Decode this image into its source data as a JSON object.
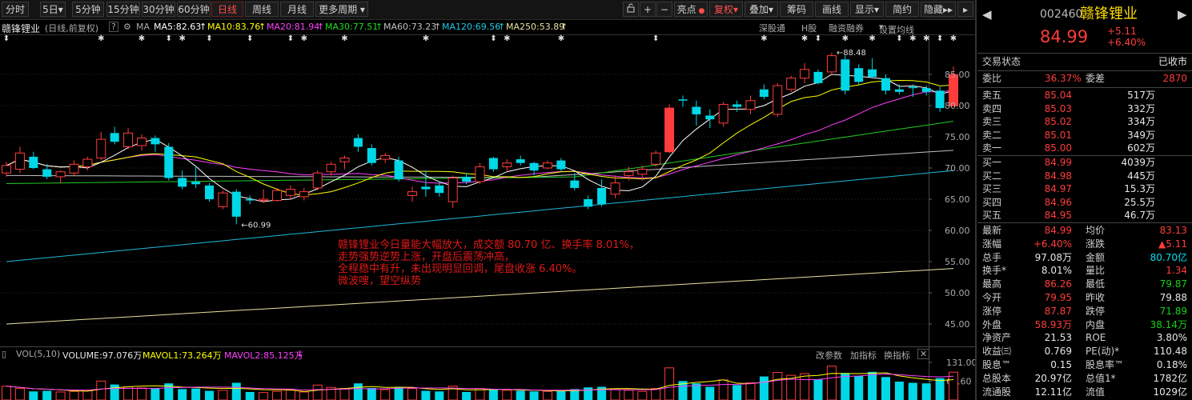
{
  "toolbar": {
    "periods": [
      "分时",
      "5日",
      "5分钟",
      "15分钟",
      "30分钟",
      "60分钟",
      "日线",
      "周线",
      "月线",
      "更多周期"
    ],
    "active_period": "日线",
    "right_buttons": [
      "亮点",
      "复权",
      "叠加",
      "筹码",
      "画线",
      "显示",
      "简约",
      "隐藏"
    ],
    "zoom_in": "+",
    "zoom_out": "−"
  },
  "ma_bar": {
    "stock_label": "赣锋锂业",
    "mode": "(日线,前复权)",
    "help": "?",
    "ma_tag": "MA",
    "ma5": "MA5:82.63",
    "ma10": "MA10:83.76",
    "ma20": "MA20:81.94",
    "ma30": "MA30:77.51",
    "ma60": "MA60:73.23",
    "ma120": "MA120:69.56",
    "ma250": "MA250:53.89",
    "arrow": "↑",
    "links": [
      "深股通",
      "H股",
      "融资融券",
      "设置均线"
    ]
  },
  "colors": {
    "up": "#ff3c3c",
    "down": "#00d8e8",
    "ma5": "#ffffff",
    "ma10": "#ffff00",
    "ma20": "#ff40ff",
    "ma30": "#22cc22",
    "ma60": "#c0c0c0",
    "ma120": "#1fb8d8",
    "ma250": "#e8e0a0"
  },
  "chart_data": {
    "type": "candlestick",
    "title": "赣锋锂业 日线 前复权",
    "ylim": [
      43,
      89
    ],
    "price_ticks": [
      85.0,
      80.0,
      75.0,
      70.0,
      65.0,
      60.0,
      55.0,
      50.0,
      45.0
    ],
    "max_label": "88.48",
    "min_label": "60.99",
    "candles": [
      {
        "o": 69.2,
        "h": 71.0,
        "l": 68.6,
        "c": 70.4
      },
      {
        "o": 69.8,
        "h": 73.4,
        "l": 69.2,
        "c": 72.4
      },
      {
        "o": 71.8,
        "h": 72.6,
        "l": 69.8,
        "c": 70.0
      },
      {
        "o": 69.8,
        "h": 70.6,
        "l": 68.2,
        "c": 68.6
      },
      {
        "o": 68.6,
        "h": 69.6,
        "l": 67.6,
        "c": 69.4
      },
      {
        "o": 69.2,
        "h": 71.2,
        "l": 68.8,
        "c": 70.6
      },
      {
        "o": 70.2,
        "h": 71.8,
        "l": 69.6,
        "c": 71.4
      },
      {
        "o": 71.6,
        "h": 75.8,
        "l": 71.2,
        "c": 74.6
      },
      {
        "o": 75.6,
        "h": 76.6,
        "l": 73.8,
        "c": 74.2
      },
      {
        "o": 73.4,
        "h": 76.4,
        "l": 73.0,
        "c": 75.6
      },
      {
        "o": 73.6,
        "h": 75.4,
        "l": 72.8,
        "c": 74.8
      },
      {
        "o": 74.8,
        "h": 75.2,
        "l": 72.6,
        "c": 73.8
      },
      {
        "o": 73.4,
        "h": 74.0,
        "l": 68.0,
        "c": 68.4
      },
      {
        "o": 68.4,
        "h": 69.6,
        "l": 66.6,
        "c": 67.0
      },
      {
        "o": 67.8,
        "h": 70.4,
        "l": 66.8,
        "c": 67.4
      },
      {
        "o": 67.2,
        "h": 67.6,
        "l": 64.6,
        "c": 65.0
      },
      {
        "o": 63.8,
        "h": 66.4,
        "l": 63.4,
        "c": 66.0
      },
      {
        "o": 66.2,
        "h": 66.6,
        "l": 60.99,
        "c": 62.2
      },
      {
        "o": 65.0,
        "h": 65.6,
        "l": 64.2,
        "c": 64.8
      },
      {
        "o": 64.8,
        "h": 66.6,
        "l": 64.4,
        "c": 65.0
      },
      {
        "o": 64.8,
        "h": 66.8,
        "l": 64.6,
        "c": 66.4
      },
      {
        "o": 65.6,
        "h": 67.2,
        "l": 65.0,
        "c": 66.6
      },
      {
        "o": 65.4,
        "h": 66.8,
        "l": 64.8,
        "c": 66.2
      },
      {
        "o": 66.8,
        "h": 69.6,
        "l": 66.4,
        "c": 69.2
      },
      {
        "o": 69.4,
        "h": 71.0,
        "l": 68.8,
        "c": 70.6
      },
      {
        "o": 71.0,
        "h": 72.0,
        "l": 69.8,
        "c": 71.6
      },
      {
        "o": 74.8,
        "h": 75.4,
        "l": 72.6,
        "c": 73.4
      },
      {
        "o": 73.2,
        "h": 73.8,
        "l": 70.4,
        "c": 70.8
      },
      {
        "o": 71.4,
        "h": 72.4,
        "l": 70.8,
        "c": 72.0
      },
      {
        "o": 71.2,
        "h": 71.8,
        "l": 67.8,
        "c": 68.2
      },
      {
        "o": 65.6,
        "h": 67.0,
        "l": 64.6,
        "c": 66.2
      },
      {
        "o": 67.0,
        "h": 69.6,
        "l": 65.4,
        "c": 66.6
      },
      {
        "o": 67.2,
        "h": 67.8,
        "l": 65.4,
        "c": 66.0
      },
      {
        "o": 64.6,
        "h": 68.8,
        "l": 63.6,
        "c": 68.4
      },
      {
        "o": 68.6,
        "h": 69.2,
        "l": 67.4,
        "c": 67.8
      },
      {
        "o": 67.8,
        "h": 70.8,
        "l": 67.4,
        "c": 70.2
      },
      {
        "o": 71.6,
        "h": 71.8,
        "l": 69.4,
        "c": 69.8
      },
      {
        "o": 70.2,
        "h": 71.4,
        "l": 69.4,
        "c": 70.8
      },
      {
        "o": 71.4,
        "h": 72.0,
        "l": 70.4,
        "c": 70.8
      },
      {
        "o": 70.8,
        "h": 71.0,
        "l": 68.8,
        "c": 69.6
      },
      {
        "o": 70.0,
        "h": 71.2,
        "l": 69.8,
        "c": 70.8
      },
      {
        "o": 71.2,
        "h": 71.6,
        "l": 69.4,
        "c": 69.8
      },
      {
        "o": 68.0,
        "h": 69.2,
        "l": 66.4,
        "c": 66.8
      },
      {
        "o": 65.0,
        "h": 65.6,
        "l": 63.4,
        "c": 63.8
      },
      {
        "o": 66.8,
        "h": 68.2,
        "l": 63.8,
        "c": 64.2
      },
      {
        "o": 65.8,
        "h": 68.8,
        "l": 65.2,
        "c": 67.6
      },
      {
        "o": 68.8,
        "h": 70.2,
        "l": 68.0,
        "c": 69.4
      },
      {
        "o": 69.0,
        "h": 70.4,
        "l": 68.0,
        "c": 69.8
      },
      {
        "o": 70.6,
        "h": 72.8,
        "l": 70.2,
        "c": 72.4
      },
      {
        "o": 72.6,
        "h": 80.2,
        "l": 72.4,
        "c": 79.6
      },
      {
        "o": 81.0,
        "h": 81.6,
        "l": 79.8,
        "c": 80.8
      },
      {
        "o": 79.8,
        "h": 80.8,
        "l": 76.8,
        "c": 78.6
      },
      {
        "o": 78.4,
        "h": 79.4,
        "l": 76.4,
        "c": 77.8
      },
      {
        "o": 77.2,
        "h": 80.6,
        "l": 76.6,
        "c": 80.2
      },
      {
        "o": 80.2,
        "h": 80.8,
        "l": 79.0,
        "c": 79.8
      },
      {
        "o": 79.4,
        "h": 81.6,
        "l": 78.6,
        "c": 80.8
      },
      {
        "o": 82.6,
        "h": 83.4,
        "l": 81.0,
        "c": 81.4
      },
      {
        "o": 78.6,
        "h": 83.6,
        "l": 78.2,
        "c": 83.2
      },
      {
        "o": 82.6,
        "h": 84.8,
        "l": 82.2,
        "c": 84.4
      },
      {
        "o": 84.4,
        "h": 86.8,
        "l": 83.6,
        "c": 85.8
      },
      {
        "o": 85.4,
        "h": 85.8,
        "l": 83.4,
        "c": 83.6
      },
      {
        "o": 85.4,
        "h": 88.48,
        "l": 84.8,
        "c": 88.0
      },
      {
        "o": 87.4,
        "h": 88.0,
        "l": 81.8,
        "c": 82.4
      },
      {
        "o": 86.0,
        "h": 86.6,
        "l": 83.4,
        "c": 83.8
      },
      {
        "o": 85.8,
        "h": 87.6,
        "l": 84.4,
        "c": 84.6
      },
      {
        "o": 84.4,
        "h": 85.0,
        "l": 81.8,
        "c": 82.4
      },
      {
        "o": 82.6,
        "h": 83.4,
        "l": 81.8,
        "c": 82.2
      },
      {
        "o": 83.0,
        "h": 83.4,
        "l": 81.4,
        "c": 82.8
      },
      {
        "o": 82.8,
        "h": 83.2,
        "l": 81.6,
        "c": 82.2
      },
      {
        "o": 82.4,
        "h": 83.0,
        "l": 79.0,
        "c": 79.6
      },
      {
        "o": 79.95,
        "h": 86.26,
        "l": 79.87,
        "c": 84.99
      }
    ],
    "volume": [
      48,
      40,
      30,
      32,
      28,
      30,
      34,
      66,
      54,
      46,
      42,
      40,
      58,
      38,
      40,
      32,
      34,
      60,
      28,
      26,
      30,
      34,
      28,
      52,
      44,
      40,
      58,
      42,
      36,
      46,
      40,
      32,
      30,
      48,
      28,
      40,
      36,
      34,
      32,
      30,
      30,
      32,
      38,
      44,
      46,
      38,
      34,
      30,
      40,
      112,
      66,
      58,
      46,
      70,
      52,
      60,
      82,
      96,
      86,
      92,
      72,
      118,
      94,
      84,
      98,
      80,
      64,
      60,
      58,
      76,
      97
    ],
    "vol_ylim": [
      0,
      131
    ],
    "vol_ticks": [
      131.0,
      65.6
    ]
  },
  "annotation": [
    "赣锋锂业今日量能大幅放大，成交额 80.70 亿、换手率 8.01%，",
    "走势强势逆势上涨，开盘后震荡冲高，",
    "全程稳中有升，未出现明显回调，尾盘收涨 6.40%。",
    "微波嗖，望空纵势"
  ],
  "vol_bar": {
    "title": "VOL(5,10)",
    "volume": "VOLUME:97.076万",
    "mavol1": "MAVOL1:73.264万",
    "mavol2": "MAVOL2:85.125万",
    "links": [
      "改参数",
      "加指标",
      "换指标"
    ]
  },
  "quote": {
    "code": "002460",
    "name": "赣锋锂业",
    "price": "84.99",
    "change": "+5.11",
    "pct": "+6.40%",
    "status_label": "交易状态",
    "status": "已收市",
    "ratio_label": "委比",
    "ratio": "36.37%",
    "diff_label": "委差",
    "diff": "2870",
    "asks": [
      {
        "label": "卖五",
        "price": "85.04",
        "vol": "517万"
      },
      {
        "label": "卖四",
        "price": "85.03",
        "vol": "332万"
      },
      {
        "label": "卖三",
        "price": "85.02",
        "vol": "334万"
      },
      {
        "label": "卖二",
        "price": "85.01",
        "vol": "349万"
      },
      {
        "label": "卖一",
        "price": "85.00",
        "vol": "602万"
      }
    ],
    "bids": [
      {
        "label": "买一",
        "price": "84.99",
        "vol": "4039万"
      },
      {
        "label": "买二",
        "price": "84.98",
        "vol": "445万"
      },
      {
        "label": "买三",
        "price": "84.97",
        "vol": "15.3万"
      },
      {
        "label": "买四",
        "price": "84.96",
        "vol": "25.5万"
      },
      {
        "label": "买五",
        "price": "84.95",
        "vol": "46.7万"
      }
    ],
    "stats": [
      {
        "l1": "最新",
        "v1": "84.99",
        "c1": "red",
        "l2": "均价",
        "v2": "83.13",
        "c2": "red"
      },
      {
        "l1": "涨幅",
        "v1": "+6.40%",
        "c1": "red",
        "l2": "涨跌",
        "v2": "▲5.11",
        "c2": "red"
      },
      {
        "l1": "总手",
        "v1": "97.08万",
        "c1": "white",
        "l2": "金额",
        "v2": "80.70亿",
        "c2": "cyan"
      },
      {
        "l1": "换手*",
        "v1": "8.01%",
        "c1": "white",
        "l2": "量比",
        "v2": "1.34",
        "c2": "red"
      },
      {
        "l1": "最高",
        "v1": "86.26",
        "c1": "red",
        "l2": "最低",
        "v2": "79.87",
        "c2": "green"
      },
      {
        "l1": "今开",
        "v1": "79.95",
        "c1": "red",
        "l2": "昨收",
        "v2": "79.88",
        "c2": "white"
      },
      {
        "l1": "涨停",
        "v1": "87.87",
        "c1": "red",
        "l2": "跌停",
        "v2": "71.89",
        "c2": "green"
      },
      {
        "l1": "外盘",
        "v1": "58.93万",
        "c1": "red",
        "l2": "内盘",
        "v2": "38.14万",
        "c2": "green"
      },
      {
        "l1": "净资产",
        "v1": "21.53",
        "c1": "white",
        "l2": "ROE",
        "v2": "3.80%",
        "c2": "white"
      },
      {
        "l1": "收益㈢",
        "v1": "0.769",
        "c1": "white",
        "l2": "PE(动)*",
        "v2": "110.48",
        "c2": "white"
      },
      {
        "l1": "股息™",
        "v1": "0.15",
        "c1": "white",
        "l2": "股息率™",
        "v2": "0.18%",
        "c2": "white"
      },
      {
        "l1": "总股本",
        "v1": "20.97亿",
        "c1": "white",
        "l2": "总值1*",
        "v2": "1782亿",
        "c2": "white"
      },
      {
        "l1": "流通股",
        "v1": "12.11亿",
        "c1": "white",
        "l2": "流值",
        "v2": "1029亿",
        "c2": "white"
      }
    ]
  }
}
